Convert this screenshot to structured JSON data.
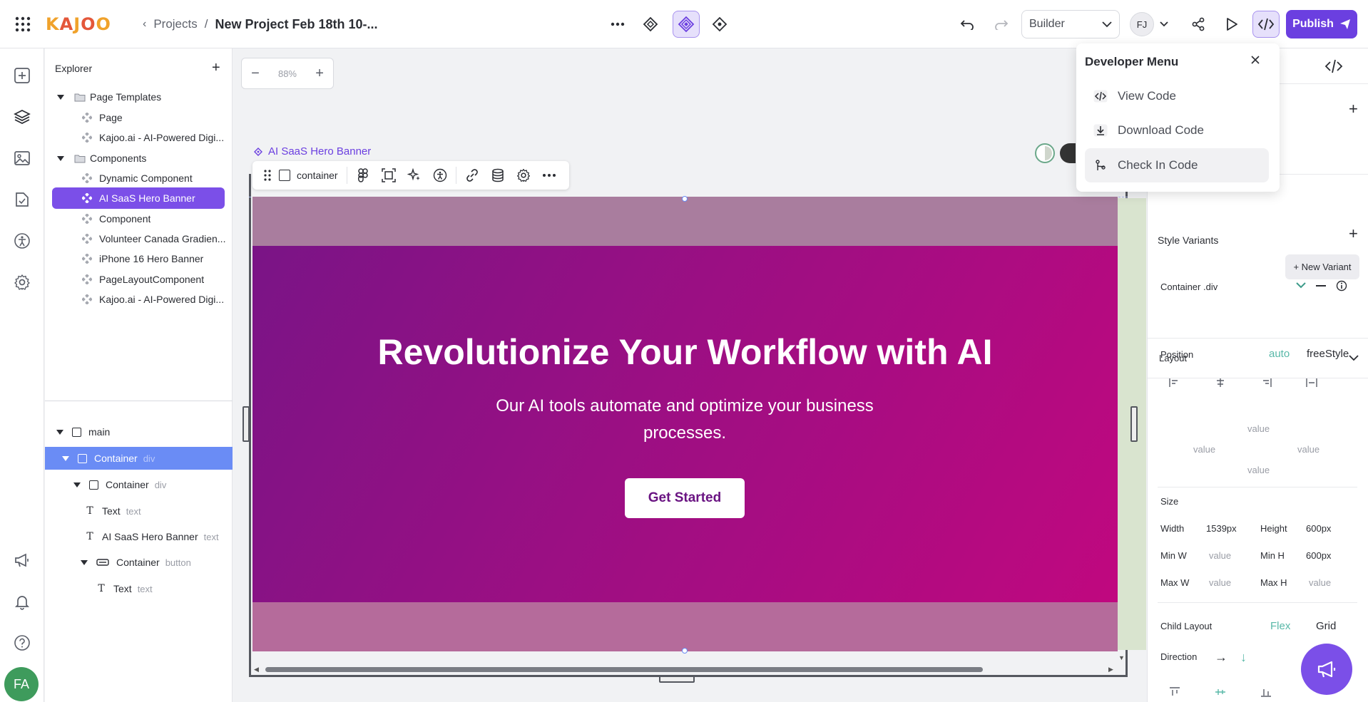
{
  "topbar": {
    "logo_letters": [
      "K",
      "A",
      "J",
      "O",
      "O"
    ],
    "logo_colors": [
      "#f0a22b",
      "#e4573a",
      "#f0a22b",
      "#e4573a",
      "#f0a22b"
    ],
    "crumb_projects": "Projects",
    "crumb_sep": "/",
    "project_name": "New Project Feb 18th 10-...",
    "mode_select": "Builder",
    "user_initials": "FJ",
    "publish_label": "Publish"
  },
  "rail": {
    "user_initials": "FA"
  },
  "explorer": {
    "title": "Explorer",
    "tree": [
      {
        "label": "Page Templates",
        "kind": "folder"
      },
      {
        "label": "Page",
        "kind": "item"
      },
      {
        "label": "Kajoo.ai - AI-Powered Digi...",
        "kind": "item"
      },
      {
        "label": "Components",
        "kind": "folder"
      },
      {
        "label": "Dynamic Component",
        "kind": "item"
      },
      {
        "label": "AI SaaS Hero Banner",
        "kind": "item",
        "selected": true
      },
      {
        "label": "Component",
        "kind": "item"
      },
      {
        "label": "Volunteer Canada Gradien...",
        "kind": "item"
      },
      {
        "label": "iPhone 16 Hero Banner",
        "kind": "item"
      },
      {
        "label": "PageLayoutComponent",
        "kind": "item"
      },
      {
        "label": "Kajoo.ai - AI-Powered Digi...",
        "kind": "item"
      }
    ],
    "layers": [
      {
        "label": "main",
        "tag": ""
      },
      {
        "label": "Container",
        "tag": "div",
        "selected": true
      },
      {
        "label": "Container",
        "tag": "div"
      },
      {
        "label": "Text",
        "tag": "text"
      },
      {
        "label": "AI SaaS Hero Banner",
        "tag": "text"
      },
      {
        "label": "Container",
        "tag": "button"
      },
      {
        "label": "Text",
        "tag": "text"
      }
    ]
  },
  "canvas": {
    "zoom": "88%",
    "component_label": "AI SaaS Hero Banner",
    "toolbar_element": "container",
    "hero_title": "Revolutionize Your Workflow with AI",
    "hero_subtitle": "Our AI tools automate and optimize your business processes.",
    "hero_button": "Get Started"
  },
  "developer_menu": {
    "title": "Developer Menu",
    "items": [
      "View Code",
      "Download Code",
      "Check In Code"
    ]
  },
  "right_panel": {
    "style_variants_label": "Style Variants",
    "variant_name": "Container .div",
    "new_variant": "+ New Variant",
    "layout_title": "Layout",
    "position_label": "Position",
    "position_auto": "auto",
    "position_free": "freeStyle",
    "value_placeholder": "value",
    "size_label": "Size",
    "width_label": "Width",
    "width_value": "1539px",
    "height_label": "Height",
    "height_value": "600px",
    "minw_label": "Min W",
    "minh_label": "Min H",
    "minh_value": "600px",
    "maxw_label": "Max W",
    "maxh_label": "Max H",
    "child_layout_label": "Child Layout",
    "flex_label": "Flex",
    "grid_label": "Grid",
    "direction_label": "Direction"
  },
  "colors": {
    "accent": "#6b3fe0",
    "selection": "#7b4fe8",
    "layer_selection": "#6a8cf5"
  }
}
